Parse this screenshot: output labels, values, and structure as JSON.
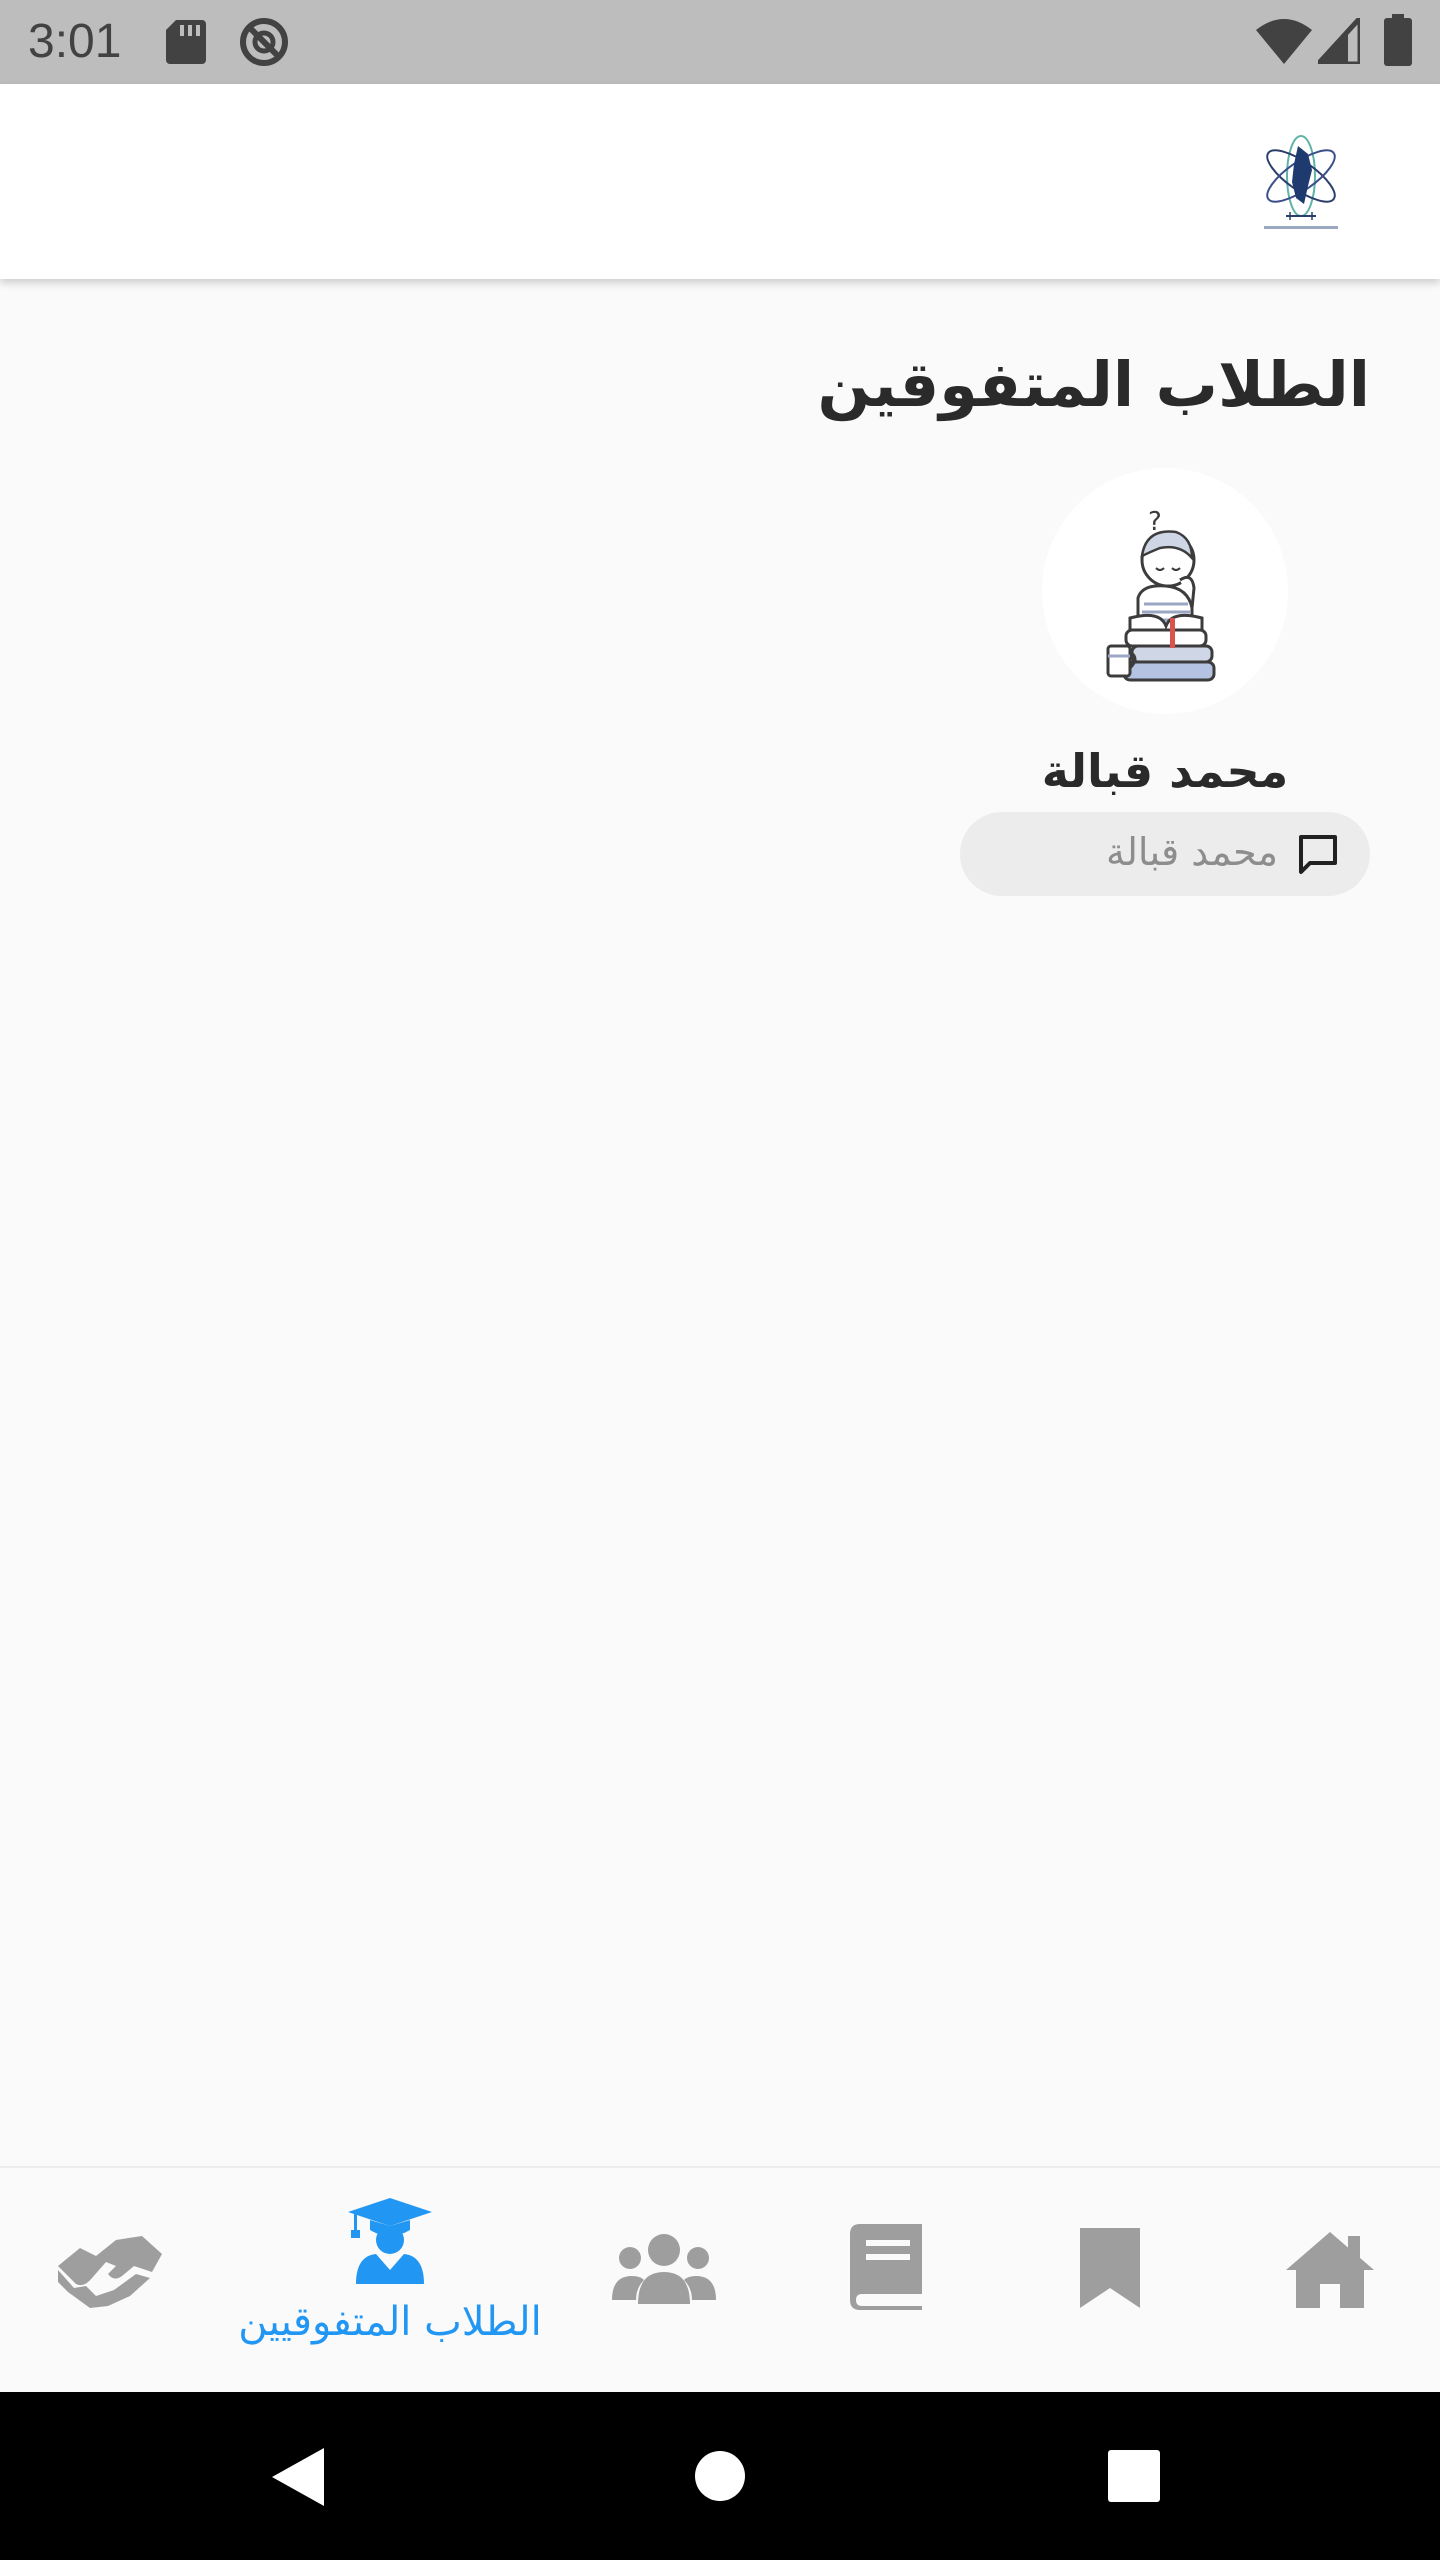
{
  "status_bar": {
    "time": "3:01",
    "icons": [
      "sd-card-icon",
      "no-sync-icon",
      "wifi-icon",
      "signal-icon",
      "battery-icon"
    ]
  },
  "app_bar": {
    "logo_icon": "atom-logo-icon"
  },
  "main": {
    "title": "الطلاب المتفوقين",
    "students": [
      {
        "name": "محمد قبالة",
        "avatar_icon": "student-reading-illustration",
        "message_label": "محمد قبالة",
        "message_icon": "chat-bubble-icon"
      }
    ]
  },
  "bottom_nav": {
    "active_color": "#2196f3",
    "inactive_color": "#9e9e9e",
    "items": [
      {
        "icon": "home-icon",
        "label": ""
      },
      {
        "icon": "bookmark-icon",
        "label": ""
      },
      {
        "icon": "book-icon",
        "label": ""
      },
      {
        "icon": "users-icon",
        "label": ""
      },
      {
        "icon": "graduate-icon",
        "label": "الطلاب المتفوقيين",
        "active": true
      },
      {
        "icon": "handshake-icon",
        "label": ""
      }
    ]
  },
  "system_nav": {
    "buttons": [
      "back-icon",
      "home-circle-icon",
      "recents-icon"
    ]
  }
}
